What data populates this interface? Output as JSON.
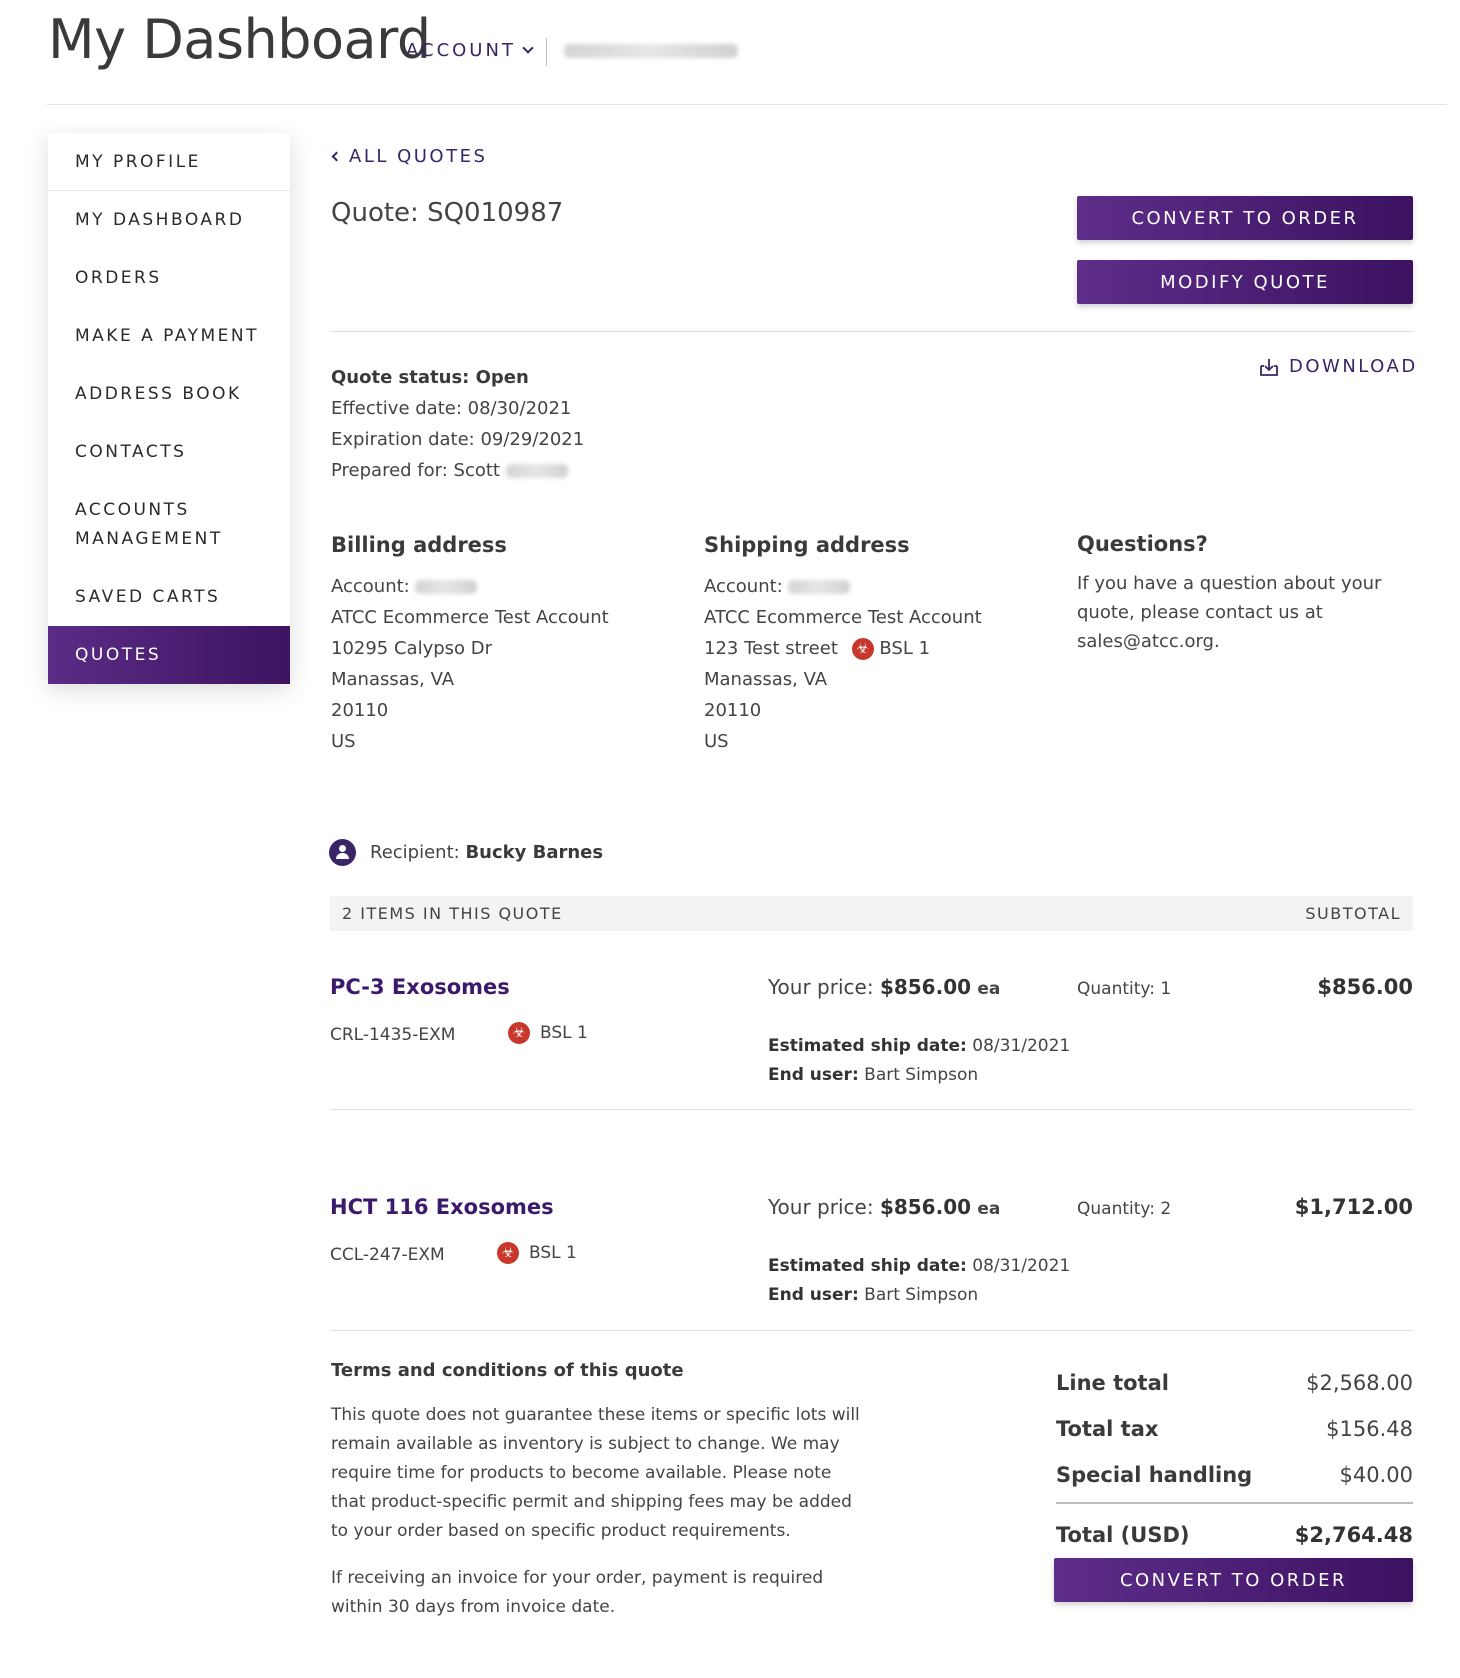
{
  "header": {
    "title": "My Dashboard",
    "account_label": "ACCOUNT"
  },
  "sidebar": {
    "items": [
      {
        "label": "MY PROFILE"
      },
      {
        "label": "MY DASHBOARD"
      },
      {
        "label": "ORDERS"
      },
      {
        "label": "MAKE A PAYMENT"
      },
      {
        "label": "ADDRESS BOOK"
      },
      {
        "label": "CONTACTS"
      },
      {
        "label": "ACCOUNTS",
        "label2": "MANAGEMENT"
      },
      {
        "label": "SAVED CARTS"
      },
      {
        "label": "QUOTES"
      }
    ]
  },
  "quote": {
    "back_label": "ALL QUOTES",
    "title": "Quote: SQ010987",
    "convert_label": "CONVERT TO ORDER",
    "modify_label": "MODIFY QUOTE",
    "download_label": "DOWNLOAD",
    "status": "Quote status: Open",
    "effective": "Effective date: 08/30/2021",
    "expiration": "Expiration date: 09/29/2021",
    "prepared_for": "Prepared for: Scott"
  },
  "billing": {
    "heading": "Billing address",
    "account_label": "Account:",
    "name": "ATCC Ecommerce Test Account",
    "street": "10295 Calypso Dr",
    "city": "Manassas, VA",
    "zip": "20110",
    "country": "US"
  },
  "shipping": {
    "heading": "Shipping address",
    "account_label": "Account:",
    "name": "ATCC Ecommerce Test Account",
    "street": "123 Test street",
    "bsl": "BSL 1",
    "city": "Manassas, VA",
    "zip": "20110",
    "country": "US"
  },
  "questions": {
    "heading": "Questions?",
    "text": "If you have a question about your quote, please contact us at sales@atcc.org."
  },
  "recipient": {
    "label": "Recipient:",
    "name": "Bucky Barnes"
  },
  "items_bar": {
    "count_label": "2 ITEMS IN THIS QUOTE",
    "subtotal_label": "SUBTOTAL"
  },
  "items": [
    {
      "name": "PC-3 Exosomes",
      "sku": "CRL-1435-EXM",
      "bsl": "BSL 1",
      "price_label": "Your price:",
      "price": "$856.00",
      "unit": "ea",
      "ship_label": "Estimated ship date:",
      "ship_date": "08/31/2021",
      "end_user_label": "End user:",
      "end_user": "Bart Simpson",
      "qty": "Quantity: 1",
      "subtotal": "$856.00"
    },
    {
      "name": "HCT 116 Exosomes",
      "sku": "CCL-247-EXM",
      "bsl": "BSL 1",
      "price_label": "Your price:",
      "price": "$856.00",
      "unit": "ea",
      "ship_label": "Estimated ship date:",
      "ship_date": "08/31/2021",
      "end_user_label": "End user:",
      "end_user": "Bart Simpson",
      "qty": "Quantity: 2",
      "subtotal": "$1,712.00"
    }
  ],
  "terms": {
    "heading": "Terms and conditions of this quote",
    "p1": "This quote does not guarantee these items or specific lots will remain available as inventory is subject to change. We may require time for products to become available. Please note that product-specific permit and shipping fees may be added to your order based on specific product requirements.",
    "p2": "If receiving an invoice for your order, payment is required within 30 days from invoice date."
  },
  "totals": {
    "line_label": "Line total",
    "line_value": "$2,568.00",
    "tax_label": "Total tax",
    "tax_value": "$156.48",
    "handling_label": "Special handling",
    "handling_value": "$40.00",
    "total_label": "Total (USD)",
    "total_value": "$2,764.48",
    "convert_label": "CONVERT TO ORDER"
  },
  "colors": {
    "brand_purple": "#4a1f73",
    "biohazard_red": "#c7372b"
  }
}
